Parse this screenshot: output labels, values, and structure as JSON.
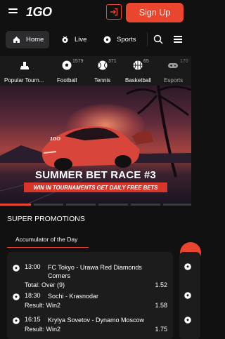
{
  "header": {
    "logo_one": "1",
    "logo_go": "GO",
    "signup_label": "Sign Up"
  },
  "nav": {
    "tabs": [
      {
        "label": "Home",
        "icon": "home-icon",
        "active": true
      },
      {
        "label": "Live",
        "icon": "live-icon",
        "active": false
      },
      {
        "label": "Sports",
        "icon": "soccer-ball-icon",
        "active": false
      }
    ]
  },
  "sports": [
    {
      "label": "Popular Tourn...",
      "count": "",
      "icon": "trophy-icon"
    },
    {
      "label": "Football",
      "count": "1579",
      "icon": "soccer-ball-icon"
    },
    {
      "label": "Tennis",
      "count": "371",
      "icon": "tennis-ball-icon"
    },
    {
      "label": "Basketball",
      "count": "65",
      "icon": "basketball-icon"
    },
    {
      "label": "Esports",
      "count": "170",
      "icon": "gamepad-icon"
    }
  ],
  "banner": {
    "car_logo": "1GO",
    "title": "SUMMER BET RACE #3",
    "subtitle": "WIN IN TOURNAMENTS GET DAILY FREE BETS"
  },
  "promotions": {
    "title": "SUPER PROMOTIONS",
    "tab_label": "Accumulator of the Day",
    "events": [
      {
        "time": "13:00",
        "teams": "FC Tokyo - Urawa Red Diamonds Corners",
        "result": "Total: Over (9)",
        "odds": "1.52"
      },
      {
        "time": "18:30",
        "teams": "Sochi - Krasnodar",
        "result": "Result: Win2",
        "odds": "1.58"
      },
      {
        "time": "16:15",
        "teams": "Krylya Sovetov - Dynamo Moscow",
        "result": "Result: Win2",
        "odds": "1.75"
      }
    ]
  },
  "colors": {
    "accent": "#e9452f",
    "background": "#111111",
    "card": "#1c1c1c"
  }
}
